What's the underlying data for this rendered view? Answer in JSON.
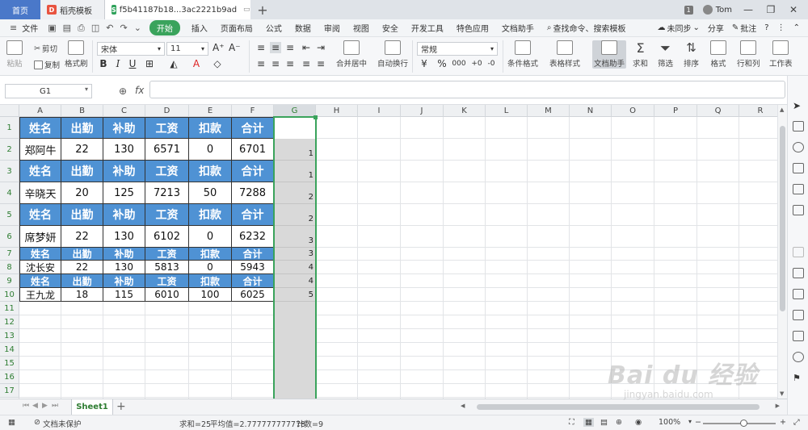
{
  "titlebar": {
    "tabs": [
      {
        "label": "首页"
      },
      {
        "label": "稻壳模板"
      },
      {
        "label": "f5b41187b18...3ac2221b9ad"
      }
    ],
    "page_count": "1",
    "user": "Tom"
  },
  "menu": {
    "file": "文件",
    "items": [
      "开始",
      "插入",
      "页面布局",
      "公式",
      "数据",
      "审阅",
      "视图",
      "安全",
      "开发工具",
      "特色应用",
      "文档助手"
    ],
    "search": "查找命令、搜索模板",
    "sync": "未同步",
    "share": "分享",
    "comment": "批注",
    "help": "?"
  },
  "ribbon": {
    "paste": "粘贴",
    "cut": "剪切",
    "copy": "复制",
    "format_painter": "格式刷",
    "font_name": "宋体",
    "font_size": "11",
    "bold": "B",
    "italic": "I",
    "underline": "U",
    "grow_font": "A⁺",
    "shrink_font": "A⁻",
    "merge_center": "合并居中",
    "wrap_text": "自动换行",
    "number_format": "常规",
    "percent": "%",
    "thousand": "000",
    "inc_decimal": "+0",
    "dec_decimal": "-0",
    "conditional_format": "条件格式",
    "table_style": "表格样式",
    "doc_assistant": "文档助手",
    "sum": "求和",
    "filter": "筛选",
    "sort": "排序",
    "format": "格式",
    "row_col": "行和列",
    "worksheet": "工作表"
  },
  "formula_bar": {
    "name_box": "G1",
    "fx": "fx",
    "formula": ""
  },
  "columns": [
    "A",
    "B",
    "C",
    "D",
    "E",
    "F",
    "G",
    "H",
    "I",
    "J",
    "K",
    "L",
    "M",
    "N",
    "O",
    "P",
    "Q",
    "R"
  ],
  "rows": [
    "1",
    "2",
    "3",
    "4",
    "5",
    "6",
    "7",
    "8",
    "9",
    "10",
    "11",
    "12",
    "13",
    "14",
    "15",
    "16",
    "17"
  ],
  "table": [
    [
      "姓名",
      "出勤",
      "补助",
      "工资",
      "扣款",
      "合计"
    ],
    [
      "郑阿牛",
      "22",
      "130",
      "6571",
      "0",
      "6701"
    ],
    [
      "姓名",
      "出勤",
      "补助",
      "工资",
      "扣款",
      "合计"
    ],
    [
      "辛晓天",
      "20",
      "125",
      "7213",
      "50",
      "7288"
    ],
    [
      "姓名",
      "出勤",
      "补助",
      "工资",
      "扣款",
      "合计"
    ],
    [
      "席梦妍",
      "22",
      "130",
      "6102",
      "0",
      "6232"
    ],
    [
      "姓名",
      "出勤",
      "补助",
      "工资",
      "扣款",
      "合计"
    ],
    [
      "沈长安",
      "22",
      "130",
      "5813",
      "0",
      "5943"
    ],
    [
      "姓名",
      "出勤",
      "补助",
      "工资",
      "扣款",
      "合计"
    ],
    [
      "王九龙",
      "18",
      "115",
      "6010",
      "100",
      "6025"
    ]
  ],
  "column_g": [
    "",
    "1",
    "1",
    "2",
    "2",
    "3",
    "3",
    "4",
    "4",
    "5"
  ],
  "sheets": [
    "Sheet1"
  ],
  "status": {
    "protect": "文档未保护",
    "sum": "求和=25",
    "average": "平均值=2.777777777778",
    "count": "计数=9",
    "zoom": "100%",
    "minus": "−",
    "plus": "+"
  },
  "watermark": {
    "main": "Bai du 经验",
    "sub": "jingyan.baidu.com"
  },
  "colors": {
    "header_fill": "#4f92d4",
    "selection": "#3aa35c",
    "home_tab": "#4a78c9"
  }
}
